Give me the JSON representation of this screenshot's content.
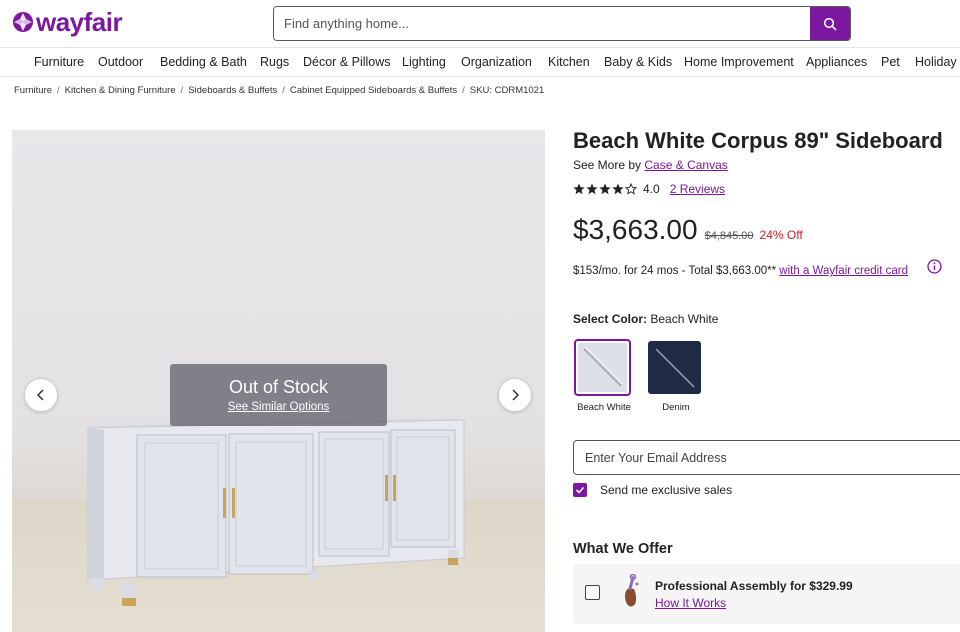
{
  "brand": {
    "name": "wayfair",
    "color": "#7b189f"
  },
  "search": {
    "placeholder": "Find anything home...",
    "icon": "search-icon"
  },
  "nav": [
    "Furniture",
    "Outdoor",
    "Bedding & Bath",
    "Rugs",
    "Décor & Pillows",
    "Lighting",
    "Organization",
    "Kitchen",
    "Baby & Kids",
    "Home Improvement",
    "Appliances",
    "Pet",
    "Holiday"
  ],
  "breadcrumb": {
    "items": [
      "Furniture",
      "Kitchen & Dining Furniture",
      "Sideboards & Buffets",
      "Cabinet Equipped Sideboards & Buffets"
    ],
    "sku": "SKU: CDRM1021"
  },
  "image": {
    "overlay_title": "Out of Stock",
    "overlay_link": "See Similar Options"
  },
  "product": {
    "title": "Beach White Corpus 89\" Sideboard",
    "see_more_prefix": "See More by",
    "brand_link": "Case & Canvas",
    "rating": "4.0",
    "rating_value": 4.0,
    "rating_max": 5,
    "reviews": "2 Reviews",
    "price": "$3,663.00",
    "old_price": "$4,845.00",
    "discount": "24% Off",
    "finance_text": "$153/mo. for 24 mos - Total $3,663.00**",
    "finance_link": "with a Wayfair credit card"
  },
  "color_select": {
    "label": "Select Color:",
    "selected": "Beach White",
    "options": [
      {
        "label": "Beach White",
        "color": "#dcdfe8"
      },
      {
        "label": "Denim",
        "color": "#1f2b45"
      }
    ]
  },
  "email": {
    "placeholder": "Enter Your Email Address",
    "checkbox_label": "Send me exclusive sales"
  },
  "offer": {
    "heading": "What We Offer",
    "title": "Professional Assembly for $329.99",
    "link": "How It Works"
  }
}
